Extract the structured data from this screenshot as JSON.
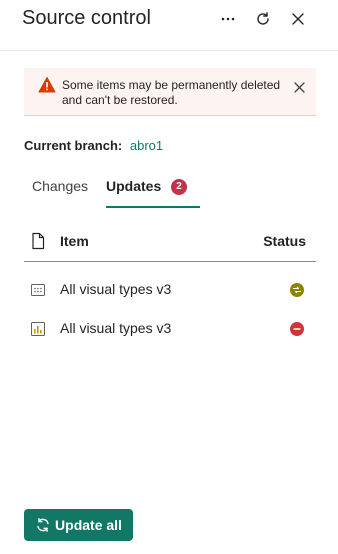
{
  "header": {
    "title": "Source control",
    "icons": [
      "more-icon",
      "refresh-icon",
      "close-icon"
    ]
  },
  "banner": {
    "message": "Some items may be permanently deleted and can't be restored.",
    "icon": "warning-icon"
  },
  "branch": {
    "label": "Current branch:",
    "value": "abro1"
  },
  "tabs": [
    {
      "label": "Changes",
      "active": false
    },
    {
      "label": "Updates",
      "active": true,
      "badge": "2"
    }
  ],
  "table": {
    "columns": [
      "Item",
      "Status"
    ],
    "rows": [
      {
        "name": "All visual types v3",
        "item_icon": "dashboard-icon",
        "status_icon": "conflict-icon"
      },
      {
        "name": "All visual types v3",
        "item_icon": "report-icon",
        "status_icon": "deleted-icon"
      }
    ]
  },
  "actions": {
    "update_all": "Update all"
  },
  "colors": {
    "accent": "#117865",
    "badge": "#c4314b",
    "warning": "#d83b01",
    "conflict": "#8a8500",
    "deleted": "#d13438",
    "banner_bg": "#fdf3f1"
  }
}
